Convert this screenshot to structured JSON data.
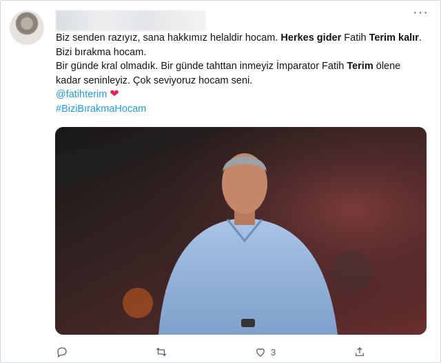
{
  "tweet": {
    "line1": {
      "part1": "Biz senden razıyız, sana hakkımız helaldir hocam. ",
      "bold1": "Herkes gider",
      "part2": " Fatih ",
      "bold2": "Terim",
      "part3": " ",
      "bold3": "kalır",
      "part4": ". Bizi bırakma hocam."
    },
    "line2": {
      "part1": "Bir günde kral olmadık. Bir günde tahttan inmeyiz İmparator Fatih ",
      "bold1": "Terim",
      "part2": " ölene kadar seninleyiz. Çok seviyoruz hocam seni."
    },
    "mention": "@fatihterim",
    "heart": "❤",
    "hashtag": "#BiziBırakmaHocam"
  },
  "actions": {
    "like_count": "3"
  }
}
